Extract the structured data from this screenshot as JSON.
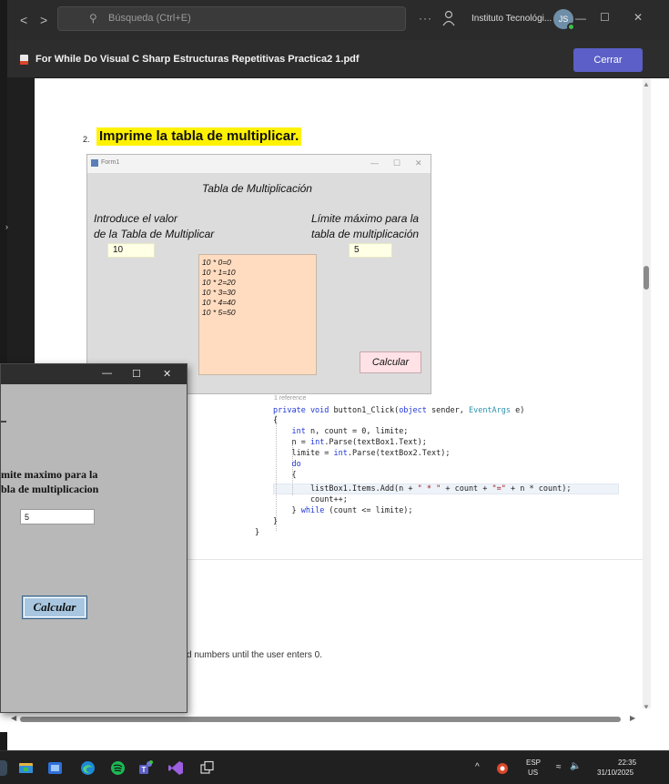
{
  "titlebar": {
    "back": "<",
    "forward": ">",
    "search_placeholder": "Búsqueda (Ctrl+E)",
    "more": "···",
    "org_name": "Instituto Tecnológi...",
    "avatar_initials": "JS",
    "minimize": "—",
    "maximize": "☐",
    "close": "✕"
  },
  "pdf": {
    "filename": "For While Do Visual C Sharp Estructuras Repetitivas Practica2 1.pdf",
    "close_label": "Cerrar"
  },
  "document": {
    "item_number": "2.",
    "heading": "Imprime la tabla de multiplicar.",
    "form1": {
      "window_title": "Form1",
      "title": "Tabla de Multiplicación",
      "left_label_1": "Introduce el valor",
      "left_label_2": "de la Tabla de Multiplicar",
      "left_value": "10",
      "right_label_1": "Límite máximo para la",
      "right_label_2": "tabla de multiplicación",
      "right_value": "5",
      "list_items": [
        "10 * 0=0",
        "10 * 1=10",
        "10 * 2=20",
        "10 * 3=30",
        "10 * 4=40",
        "10 * 5=50"
      ],
      "button": "Calcular"
    },
    "code": {
      "reference": "1 reference",
      "lines": [
        "private void button1_Click(object sender, EventArgs e)",
        "{",
        "    int n, count = 0, limite;",
        "    n = int.Parse(textBox1.Text);",
        "    limite = int.Parse(textBox2.Text);",
        "    do",
        "    {",
        "        listBox1.Items.Add(n + \" * \" + count + \"=\" + n * count);",
        "        count++;",
        "    } while (count <= limite);",
        "}",
        "}"
      ]
    },
    "paragraph_fragment": "d numbers until the user enters 0."
  },
  "floating_window": {
    "minimize": "—",
    "maximize": "☐",
    "close": "✕",
    "label_line_1": "mite maximo para la",
    "label_line_2": "bla de multiplicacion",
    "input_value": "5",
    "button": "Calcular"
  },
  "taskbar": {
    "lang_1": "ESP",
    "lang_2": "US",
    "time": "22:35",
    "date": "31/10/2025",
    "icons": [
      "widgets-icon",
      "file-explorer-icon",
      "edge-icon",
      "spotify-icon",
      "teams-icon",
      "visual-studio-icon",
      "task-view-icon"
    ]
  }
}
